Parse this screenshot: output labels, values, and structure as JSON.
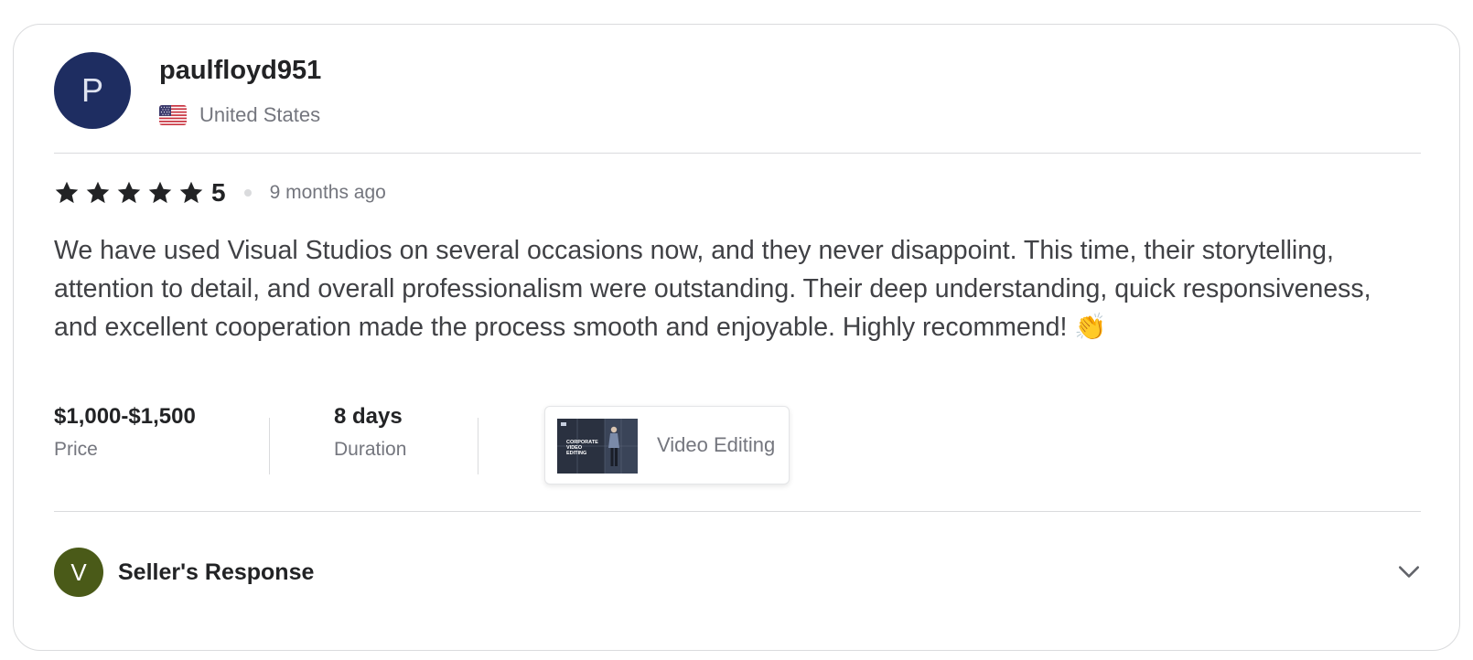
{
  "reviewer": {
    "avatar_initial": "P",
    "username": "paulfloyd951",
    "country": "United States",
    "flag_icon": "us-flag-icon"
  },
  "review": {
    "rating_stars": 5,
    "rating_value": "5",
    "time_ago": "9 months ago",
    "text": "We have used Visual Studios on several occasions now, and they never disappoint. This time, their storytelling, attention to detail, and overall professionalism were outstanding. Their deep understanding, quick responsiveness, and excellent cooperation made the process smooth and enjoyable. Highly recommend! 👏"
  },
  "meta": {
    "price_value": "$1,000-$1,500",
    "price_label": "Price",
    "duration_value": "8 days",
    "duration_label": "Duration"
  },
  "gig": {
    "title": "Video Editing",
    "thumbnail_text": "CORPORATE VIDEO EDITING"
  },
  "seller_response": {
    "avatar_initial": "V",
    "label": "Seller's Response",
    "toggle_icon": "chevron-down-icon"
  },
  "colors": {
    "reviewer_avatar_bg": "#1e2d61",
    "seller_avatar_bg": "#4a5a18",
    "star": "#222325",
    "muted_text": "#74767e",
    "border": "#dadbdd"
  }
}
